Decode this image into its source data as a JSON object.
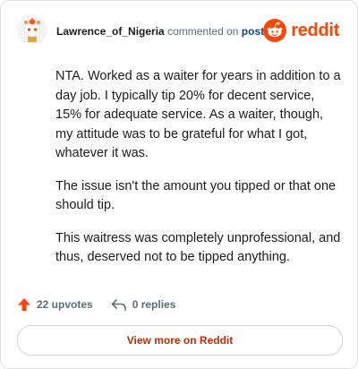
{
  "header": {
    "username": "Lawrence_of_Nigeria",
    "commented_text": "commented on",
    "post_link": "post",
    "brand": "reddit",
    "brand_color": "#ff4500"
  },
  "comment": {
    "paragraphs": [
      "NTA. Worked as a waiter for years in addition to a day job. I typically tip 20% for decent service, 15% for adequate service. As a waiter, though, my attitude was to be grateful for what I got, whatever it was.",
      "The issue isn't the amount you tipped or that one should tip.",
      "This waitress was completely unprofessional, and thus, deserved not to be tipped anything."
    ]
  },
  "actions": {
    "upvotes_label": "22 upvotes",
    "replies_label": "0 replies",
    "upvote_icon": "upvote-arrow-icon",
    "reply_icon": "reply-arrow-icon"
  },
  "footer": {
    "view_more_label": "View more on Reddit"
  }
}
